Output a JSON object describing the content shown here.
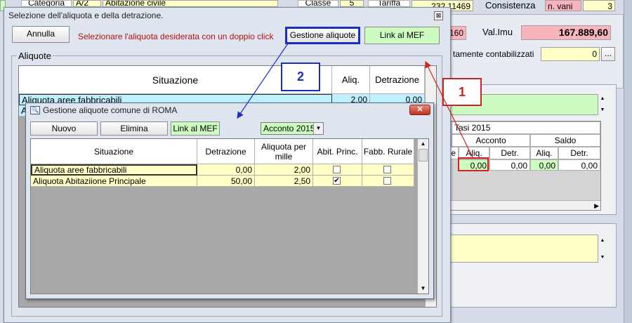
{
  "background": {
    "top_row": {
      "categoria_label": "Categoria",
      "categoria_value": "A/2",
      "descr_value": "Abitazione civile",
      "classe_label": "Classe",
      "classe_value": "5",
      "tariffa_label": "Tariffa",
      "tariffa_value": "232,11469",
      "consistenza_label": "Consistenza",
      "consistenza_unit": "n. vani",
      "consistenza_value": "3"
    },
    "rendita_value": "160",
    "val_imu_label": "Val.Imu",
    "val_imu_value": "167.889,60",
    "contabilizzati_label": "tamente contabilizzati",
    "contabilizzati_value": "0",
    "ellipsis_button": "...",
    "tasi": {
      "title": "Tasi 2015",
      "acconto_label": "Acconto",
      "saldo_label": "Saldo",
      "col_e": "e",
      "aliq_label": "Aliq.",
      "detr_label": "Detr.",
      "row": [
        "0,00",
        "0,00",
        "0,00",
        "0,00"
      ]
    }
  },
  "dialog1": {
    "title": "Selezione dell'aliquota e della detrazione.",
    "annulla_label": "Annulla",
    "instruction": "Selezionare l'aliquota desiderata con un doppio click",
    "gestione_label": "Gestione aliquote",
    "link_mef_label": "Link al MEF",
    "group_label": "Aliquote",
    "columns": [
      "Situazione",
      "Aliq.",
      "Detrazione"
    ],
    "rows": [
      {
        "situazione": "Aliquota aree fabbricabili",
        "aliq": "2,00",
        "detrazione": "0,00"
      },
      {
        "situazione": "A",
        "aliq": "",
        "detrazione": ""
      }
    ]
  },
  "dialog2": {
    "title": "Gestione aliquote comune di ROMA",
    "nuovo_label": "Nuovo",
    "elimina_label": "Elimina",
    "link_mef_label": "Link al MEF",
    "period_select": "Acconto 2015",
    "columns": [
      "Situazione",
      "Detrazione",
      "Aliquota per mille",
      "Abit. Princ.",
      "Fabb. Rurale"
    ],
    "rows": [
      {
        "situazione": "Aliquota aree fabbricabili",
        "detrazione": "0,00",
        "aliquota": "2,00",
        "abit": false,
        "fabb": false
      },
      {
        "situazione": "Aliquota Abitaziione Principale",
        "detrazione": "50,00",
        "aliquota": "2,50",
        "abit": true,
        "fabb": false
      }
    ]
  },
  "callouts": [
    "1",
    "2"
  ],
  "colors": {
    "callout_red": "#d42020",
    "callout_blue": "#1a2fc0",
    "yellow_field": "#ffffc6",
    "green_field": "#ccfcc0",
    "pink_field": "#f8b4bc"
  }
}
